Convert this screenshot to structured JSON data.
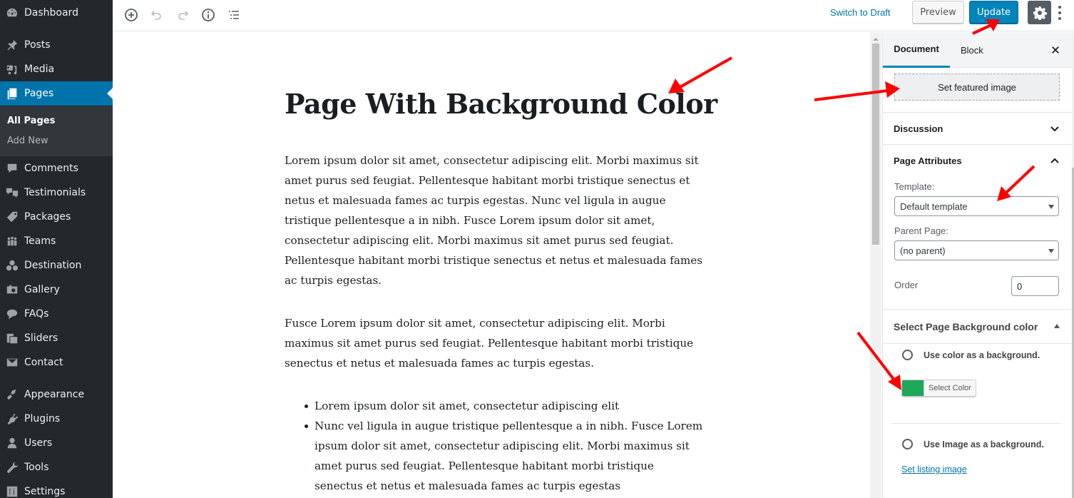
{
  "admin_menu": {
    "items": [
      {
        "label": "Dashboard",
        "icon": "dashboard-icon"
      },
      {
        "label": "Posts",
        "icon": "pin-icon"
      },
      {
        "label": "Media",
        "icon": "media-icon"
      },
      {
        "label": "Pages",
        "icon": "pages-icon",
        "active": true
      },
      {
        "label": "Comments",
        "icon": "comment-icon"
      },
      {
        "label": "Testimonials",
        "icon": "testimonials-icon"
      },
      {
        "label": "Packages",
        "icon": "tag-icon"
      },
      {
        "label": "Teams",
        "icon": "groups-icon"
      },
      {
        "label": "Destination",
        "icon": "location-icon"
      },
      {
        "label": "Gallery",
        "icon": "camera-icon"
      },
      {
        "label": "FAQs",
        "icon": "chat-icon"
      },
      {
        "label": "Sliders",
        "icon": "slides-icon"
      },
      {
        "label": "Contact",
        "icon": "email-icon"
      },
      {
        "label": "Appearance",
        "icon": "brush-icon"
      },
      {
        "label": "Plugins",
        "icon": "plug-icon"
      },
      {
        "label": "Users",
        "icon": "user-icon"
      },
      {
        "label": "Tools",
        "icon": "wrench-icon"
      },
      {
        "label": "Settings",
        "icon": "settings-sliders-icon"
      }
    ],
    "submenu": [
      {
        "label": "All Pages",
        "current": true
      },
      {
        "label": "Add New"
      }
    ]
  },
  "toolbar": {
    "add_block": "add-block-icon",
    "undo": "undo-icon",
    "redo": "redo-icon",
    "info": "info-icon",
    "outline": "outline-icon",
    "switch_to_draft": "Switch to Draft",
    "preview": "Preview",
    "update": "Update"
  },
  "editor": {
    "title": "Page With Background Color",
    "paragraphs": [
      "Lorem ipsum dolor sit amet, consectetur adipiscing elit. Morbi maximus sit amet purus sed feugiat. Pellentesque habitant morbi tristique senectus et netus et malesuada fames ac turpis egestas. Nunc vel ligula in augue tristique pellentesque a in nibh. Fusce Lorem ipsum dolor sit amet, consectetur adipiscing elit. Morbi maximus sit amet purus sed feugiat. Pellentesque habitant morbi tristique senectus et netus et malesuada fames ac turpis egestas.",
      "Fusce Lorem ipsum dolor sit amet, consectetur adipiscing elit. Morbi maximus sit amet purus sed feugiat. Pellentesque habitant morbi tristique senectus et netus et malesuada fames ac turpis egestas."
    ],
    "list": [
      "Lorem ipsum dolor sit amet, consectetur adipiscing elit",
      "Nunc vel ligula in augue tristique pellentesque a in nibh. Fusce Lorem ipsum dolor sit amet, consectetur adipiscing elit. Morbi maximus sit amet purus sed feugiat. Pellentesque habitant morbi tristique senectus et netus et malesuada fames ac turpis egestas"
    ]
  },
  "settings": {
    "tabs": {
      "document": "Document",
      "block": "Block"
    },
    "featured_image_button": "Set featured image",
    "discussion": "Discussion",
    "page_attributes": {
      "heading": "Page Attributes",
      "template_label": "Template:",
      "template_value": "Default template",
      "parent_label": "Parent Page:",
      "parent_value": "(no parent)",
      "order_label": "Order",
      "order_value": "0"
    },
    "background": {
      "heading": "Select Page Background color",
      "use_color_label": "Use color as a background.",
      "select_color_label": "Select Color",
      "selected_color": "#1fa75a",
      "use_image_label": "Use Image as a background.",
      "listing_image_link": "Set listing image"
    }
  },
  "colors": {
    "accent": "#0085ba",
    "admin_bg": "#23282d",
    "annotation": "#ff0000"
  }
}
